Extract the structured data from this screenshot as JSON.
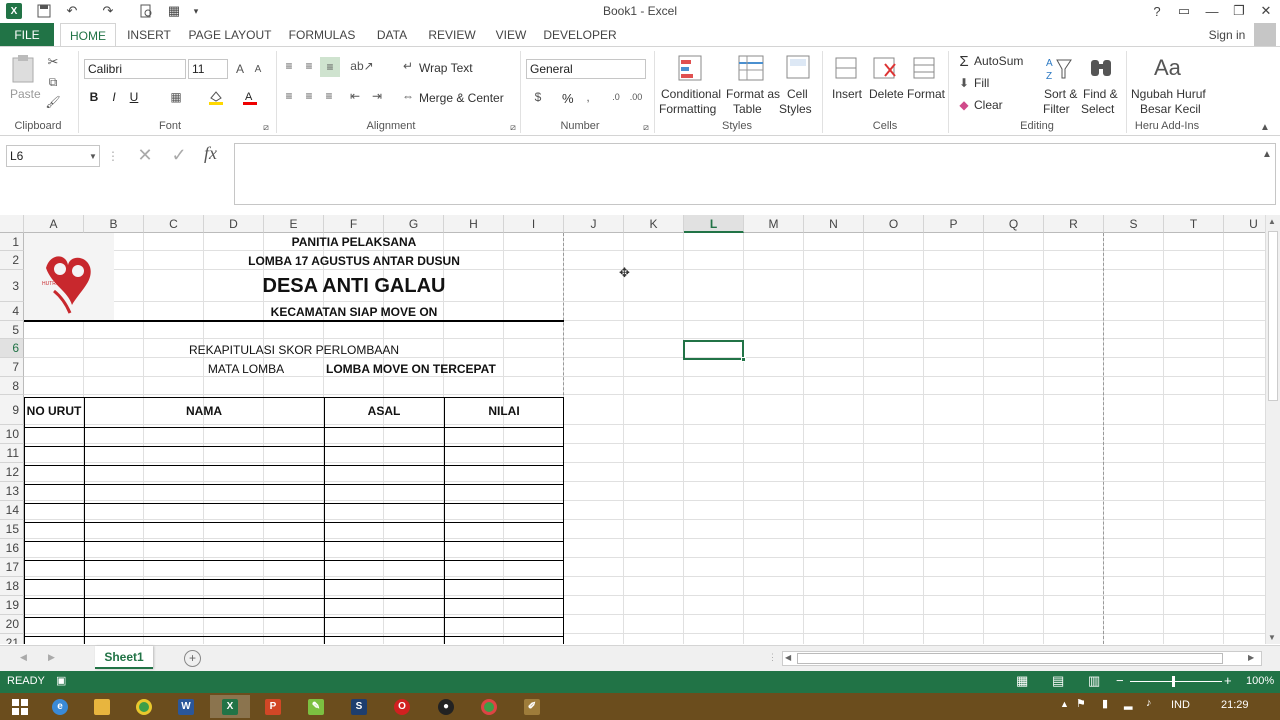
{
  "window": {
    "title": "Book1 - Excel",
    "signin": "Sign in"
  },
  "tabs": [
    "FILE",
    "HOME",
    "INSERT",
    "PAGE LAYOUT",
    "FORMULAS",
    "DATA",
    "REVIEW",
    "VIEW",
    "DEVELOPER"
  ],
  "ribbon": {
    "paste": "Paste",
    "font_name": "Calibri",
    "font_size": "11",
    "wrap_text": "Wrap Text",
    "merge_center": "Merge & Center",
    "number_format": "General",
    "percent": "%",
    "conditional_1": "Conditional",
    "conditional_2": "Formatting",
    "format_as_1": "Format as",
    "format_as_2": "Table",
    "cell_styles_1": "Cell",
    "cell_styles_2": "Styles",
    "insert": "Insert",
    "delete": "Delete",
    "format": "Format",
    "autosum": "AutoSum",
    "fill": "Fill",
    "clear": "Clear",
    "sort_1": "Sort &",
    "sort_2": "Filter",
    "find_1": "Find &",
    "find_2": "Select",
    "addin_icon": "Aa",
    "addin_1": "Ngubah Huruf",
    "addin_2": "Besar Kecil",
    "groups": {
      "clipboard": "Clipboard",
      "font": "Font",
      "alignment": "Alignment",
      "number": "Number",
      "styles": "Styles",
      "cells": "Cells",
      "editing": "Editing",
      "addins": "Heru Add-Ins"
    }
  },
  "formula_bar": {
    "name_box": "L6",
    "fx": "fx",
    "formula": ""
  },
  "columns": [
    "A",
    "B",
    "C",
    "D",
    "E",
    "F",
    "G",
    "H",
    "I",
    "J",
    "K",
    "L",
    "M",
    "N",
    "O",
    "P",
    "Q",
    "R",
    "S",
    "T",
    "U"
  ],
  "selected_column": "L",
  "rows": [
    "1",
    "2",
    "3",
    "4",
    "5",
    "6",
    "7",
    "8",
    "9",
    "10",
    "11",
    "12",
    "13",
    "14",
    "15",
    "16",
    "17",
    "18",
    "19",
    "20",
    "21"
  ],
  "selected_row": "6",
  "sheet": {
    "header1": "PANITIA PELAKSANA",
    "header2": "LOMBA 17 AGUSTUS ANTAR DUSUN",
    "header3": "DESA ANTI GALAU",
    "header4": "KECAMATAN SIAP MOVE ON",
    "recap": "REKAPITULASI SKOR PERLOMBAAN",
    "mata_lomba_label": "MATA LOMBA",
    "mata_lomba_value": "LOMBA MOVE ON TERCEPAT",
    "table_headers": [
      "NO URUT",
      "NAMA",
      "ASAL",
      "NILAI"
    ],
    "logo_text": "HUTRU"
  },
  "sheet_tabs": [
    "Sheet1"
  ],
  "status": {
    "ready": "READY",
    "zoom": "100%"
  },
  "taskbar": {
    "lang": "IND",
    "time": "21:29"
  },
  "colors": {
    "excel_green": "#217346",
    "taskbar": "#6b4d1d",
    "logo_red": "#c8282d"
  }
}
